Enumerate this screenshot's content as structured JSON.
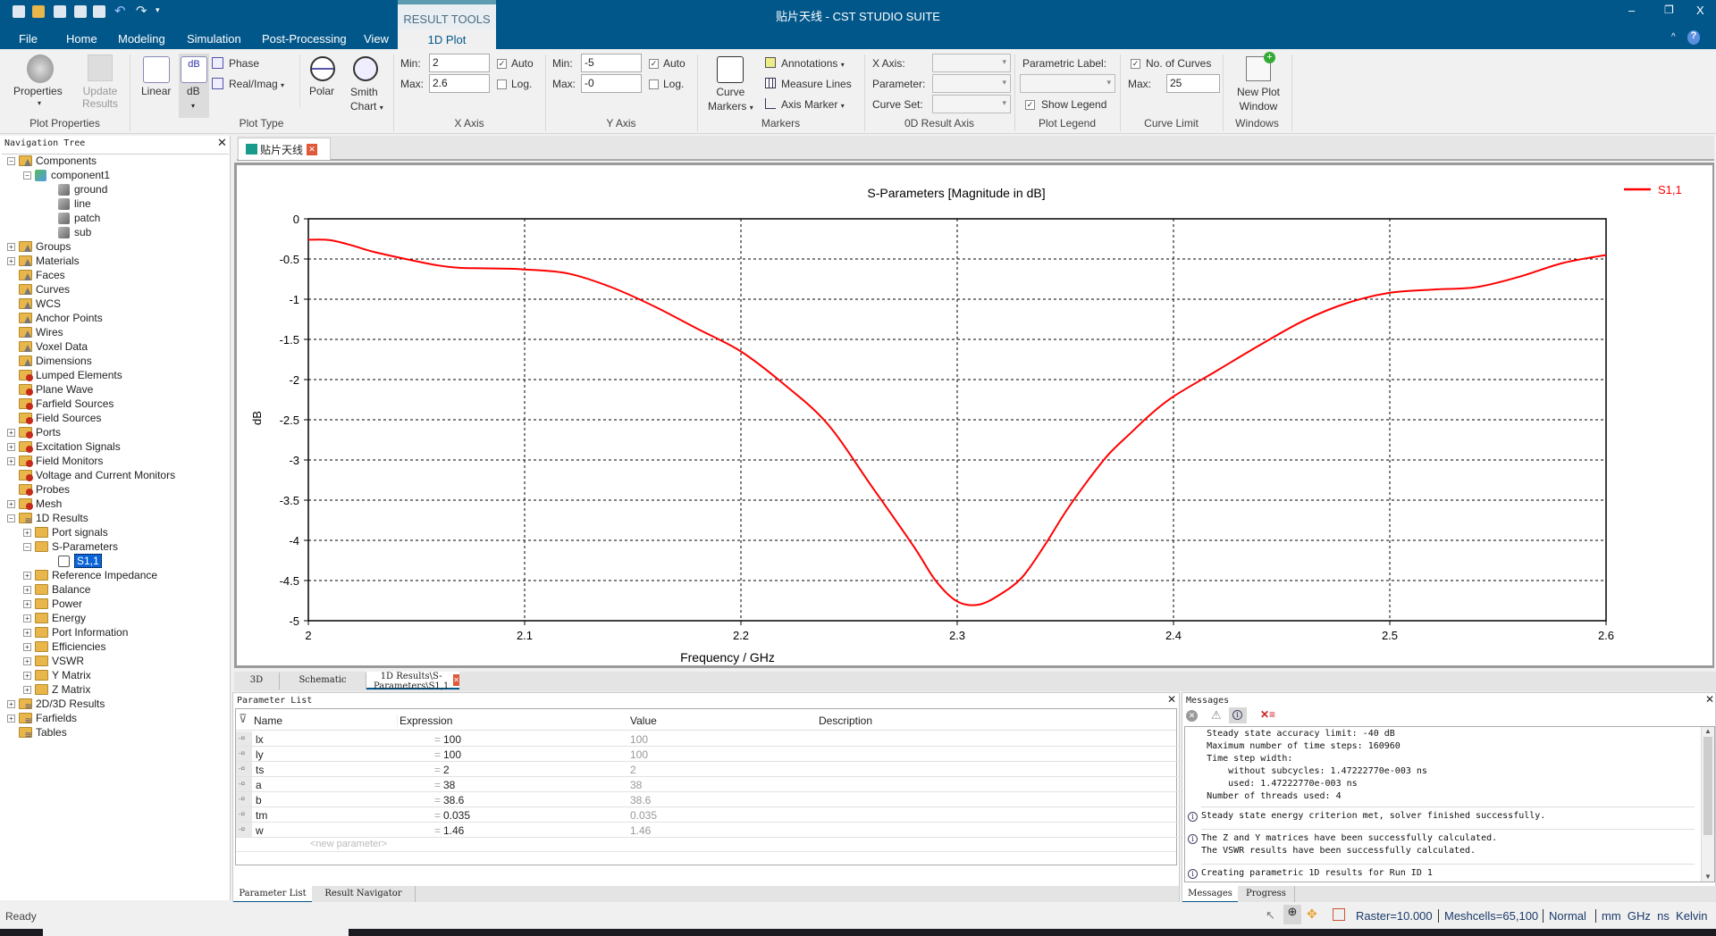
{
  "window": {
    "title": "贴片天线 - CST STUDIO SUITE",
    "minimize": "‒",
    "restore": "❐",
    "close": "X"
  },
  "menu": {
    "file": "File",
    "tabs": [
      "Home",
      "Modeling",
      "Simulation",
      "Post-Processing",
      "View"
    ],
    "context_header": "RESULT TOOLS",
    "context_tab": "1D Plot",
    "help": "?"
  },
  "ribbon": {
    "plot_properties": {
      "label": "Plot Properties",
      "properties": "Properties",
      "update": "Update",
      "results": "Results"
    },
    "plot_type": {
      "label": "Plot Type",
      "linear": "Linear",
      "db": "dB",
      "phase": "Phase",
      "realimag": "Real/Imag",
      "polar": "Polar",
      "smith1": "Smith",
      "smith2": "Chart"
    },
    "x_axis": {
      "label": "X Axis",
      "min_label": "Min:",
      "min": "2",
      "max_label": "Max:",
      "max": "2.6",
      "auto": "Auto",
      "auto_checked": true,
      "log": "Log.",
      "log_checked": false
    },
    "y_axis": {
      "label": "Y Axis",
      "min_label": "Min:",
      "min": "-5",
      "max_label": "Max:",
      "max": "-0",
      "auto": "Auto",
      "auto_checked": true,
      "log": "Log.",
      "log_checked": false
    },
    "markers": {
      "label": "Markers",
      "curve1": "Curve",
      "curve2": "Markers",
      "annotations": "Annotations",
      "measure": "Measure Lines",
      "axis_marker": "Axis Marker"
    },
    "od_axis": {
      "label": "0D Result Axis",
      "x_axis": "X Axis:",
      "parameter": "Parameter:",
      "curve_set": "Curve Set:"
    },
    "legend": {
      "label": "Plot Legend",
      "parametric": "Parametric Label:",
      "show_legend": "Show Legend",
      "show_checked": true
    },
    "curve_limit": {
      "label": "Curve Limit",
      "no_curves": "No. of Curves",
      "checked": true,
      "max_label": "Max:",
      "max": "25"
    },
    "windows": {
      "label": "Windows",
      "new1": "New Plot",
      "new2": "Window"
    }
  },
  "nav": {
    "title": "Navigation Tree",
    "items": [
      {
        "label": "Components",
        "lvl": 0,
        "pm": "−",
        "icon": "gray"
      },
      {
        "label": "component1",
        "lvl": 1,
        "pm": "−",
        "icon": "comp"
      },
      {
        "label": "ground",
        "lvl": 2,
        "icon": "cube"
      },
      {
        "label": "line",
        "lvl": 2,
        "icon": "cube"
      },
      {
        "label": "patch",
        "lvl": 2,
        "icon": "cube"
      },
      {
        "label": "sub",
        "lvl": 2,
        "icon": "cube"
      },
      {
        "label": "Groups",
        "lvl": 0,
        "pm": "+",
        "icon": "gray"
      },
      {
        "label": "Materials",
        "lvl": 0,
        "pm": "+",
        "icon": "gray"
      },
      {
        "label": "Faces",
        "lvl": 0,
        "icon": "gray"
      },
      {
        "label": "Curves",
        "lvl": 0,
        "icon": "gray"
      },
      {
        "label": "WCS",
        "lvl": 0,
        "icon": "gray"
      },
      {
        "label": "Anchor Points",
        "lvl": 0,
        "icon": "gray"
      },
      {
        "label": "Wires",
        "lvl": 0,
        "icon": "gray"
      },
      {
        "label": "Voxel Data",
        "lvl": 0,
        "icon": "gray"
      },
      {
        "label": "Dimensions",
        "lvl": 0,
        "icon": "gray"
      },
      {
        "label": "Lumped Elements",
        "lvl": 0,
        "icon": "red"
      },
      {
        "label": "Plane Wave",
        "lvl": 0,
        "icon": "red"
      },
      {
        "label": "Farfield Sources",
        "lvl": 0,
        "icon": "red"
      },
      {
        "label": "Field Sources",
        "lvl": 0,
        "icon": "red"
      },
      {
        "label": "Ports",
        "lvl": 0,
        "pm": "+",
        "icon": "red"
      },
      {
        "label": "Excitation Signals",
        "lvl": 0,
        "pm": "+",
        "icon": "red"
      },
      {
        "label": "Field Monitors",
        "lvl": 0,
        "pm": "+",
        "icon": "red"
      },
      {
        "label": "Voltage and Current Monitors",
        "lvl": 0,
        "icon": "red"
      },
      {
        "label": "Probes",
        "lvl": 0,
        "icon": "red"
      },
      {
        "label": "Mesh",
        "lvl": 0,
        "pm": "+",
        "icon": "red"
      },
      {
        "label": "1D Results",
        "lvl": 0,
        "pm": "−",
        "icon": "stack"
      },
      {
        "label": "Port signals",
        "lvl": 1,
        "pm": "+",
        "icon": "plain"
      },
      {
        "label": "S-Parameters",
        "lvl": 1,
        "pm": "−",
        "icon": "plain"
      },
      {
        "label": "S1,1",
        "lvl": 2,
        "icon": "curve",
        "selected": true
      },
      {
        "label": "Reference Impedance",
        "lvl": 1,
        "pm": "+",
        "icon": "plain"
      },
      {
        "label": "Balance",
        "lvl": 1,
        "pm": "+",
        "icon": "plain"
      },
      {
        "label": "Power",
        "lvl": 1,
        "pm": "+",
        "icon": "plain"
      },
      {
        "label": "Energy",
        "lvl": 1,
        "pm": "+",
        "icon": "plain"
      },
      {
        "label": "Port Information",
        "lvl": 1,
        "pm": "+",
        "icon": "plain"
      },
      {
        "label": "Efficiencies",
        "lvl": 1,
        "pm": "+",
        "icon": "plain"
      },
      {
        "label": "VSWR",
        "lvl": 1,
        "pm": "+",
        "icon": "plain"
      },
      {
        "label": "Y Matrix",
        "lvl": 1,
        "pm": "+",
        "icon": "plain"
      },
      {
        "label": "Z Matrix",
        "lvl": 1,
        "pm": "+",
        "icon": "plain"
      },
      {
        "label": "2D/3D Results",
        "lvl": 0,
        "pm": "+",
        "icon": "stack"
      },
      {
        "label": "Farfields",
        "lvl": 0,
        "pm": "+",
        "icon": "stack"
      },
      {
        "label": "Tables",
        "lvl": 0,
        "icon": "stack"
      }
    ]
  },
  "doc_tab": {
    "label": "贴片天线"
  },
  "view_tabs": [
    "3D",
    "Schematic",
    "1D Results\\S-Parameters\\S1,1"
  ],
  "chart_data": {
    "type": "line",
    "title": "S-Parameters [Magnitude in dB]",
    "xlabel": "Frequency / GHz",
    "ylabel": "dB",
    "xlim": [
      2,
      2.6
    ],
    "ylim": [
      -5,
      0
    ],
    "xticks": [
      "2",
      "2.1",
      "2.2",
      "2.3",
      "2.4",
      "2.5",
      "2.6"
    ],
    "yticks": [
      "0",
      "-0.5",
      "-1",
      "-1.5",
      "-2",
      "-2.5",
      "-3",
      "-3.5",
      "-4",
      "-4.5",
      "-5"
    ],
    "grid": true,
    "legend_placement": "top-right outside",
    "series": [
      {
        "name": "S1,1",
        "color": "#ff0000",
        "x": [
          2.0,
          2.01,
          2.02,
          2.03,
          2.045,
          2.06,
          2.07,
          2.08,
          2.09,
          2.1,
          2.12,
          2.14,
          2.16,
          2.18,
          2.2,
          2.22,
          2.24,
          2.26,
          2.28,
          2.29,
          2.3,
          2.31,
          2.32,
          2.33,
          2.34,
          2.35,
          2.36,
          2.37,
          2.38,
          2.39,
          2.4,
          2.42,
          2.44,
          2.46,
          2.48,
          2.5,
          2.52,
          2.54,
          2.56,
          2.58,
          2.6
        ],
        "y": [
          -0.26,
          -0.265,
          -0.33,
          -0.41,
          -0.5,
          -0.58,
          -0.61,
          -0.615,
          -0.62,
          -0.63,
          -0.68,
          -0.85,
          -1.09,
          -1.37,
          -1.65,
          -2.06,
          -2.55,
          -3.31,
          -4.08,
          -4.5,
          -4.76,
          -4.8,
          -4.67,
          -4.46,
          -4.08,
          -3.65,
          -3.27,
          -2.93,
          -2.67,
          -2.42,
          -2.21,
          -1.89,
          -1.57,
          -1.27,
          -1.05,
          -0.92,
          -0.88,
          -0.85,
          -0.72,
          -0.55,
          -0.45
        ]
      }
    ]
  },
  "params": {
    "title": "Parameter List",
    "headers": [
      "Name",
      "Expression",
      "Value",
      "Description"
    ],
    "rows": [
      [
        "lx",
        "100",
        "100"
      ],
      [
        "ly",
        "100",
        "100"
      ],
      [
        "ts",
        "2",
        "2"
      ],
      [
        "a",
        "38",
        "38"
      ],
      [
        "b",
        "38.6",
        "38.6"
      ],
      [
        "tm",
        "0.035",
        "0.035"
      ],
      [
        "w",
        "1.46",
        "1.46"
      ]
    ],
    "new_placeholder": "<new parameter>",
    "tabs": [
      "Parameter List",
      "Result Navigator"
    ]
  },
  "messages": {
    "title": "Messages",
    "tabs": [
      "Messages",
      "Progress"
    ],
    "lines": [
      "    Steady state accuracy limit: -40 dB",
      "    Maximum number of time steps: 160960",
      "    Time step width:",
      "        without subcycles: 1.47222770e-003 ns",
      "        used: 1.47222770e-003 ns",
      "    Number of threads used: 4"
    ],
    "info": [
      [
        "Steady state energy criterion met, solver finished successfully."
      ],
      [
        "The Z and Y matrices have been successfully calculated.",
        "The VSWR results have been successfully calculated."
      ],
      [
        "Creating parametric 1D results for Run ID 1"
      ]
    ]
  },
  "status": {
    "ready": "Ready",
    "raster": "Raster=10.000",
    "meshcells": "Meshcells=65,100",
    "mode": "Normal",
    "units": "mm  GHz  ns  Kelvin"
  }
}
